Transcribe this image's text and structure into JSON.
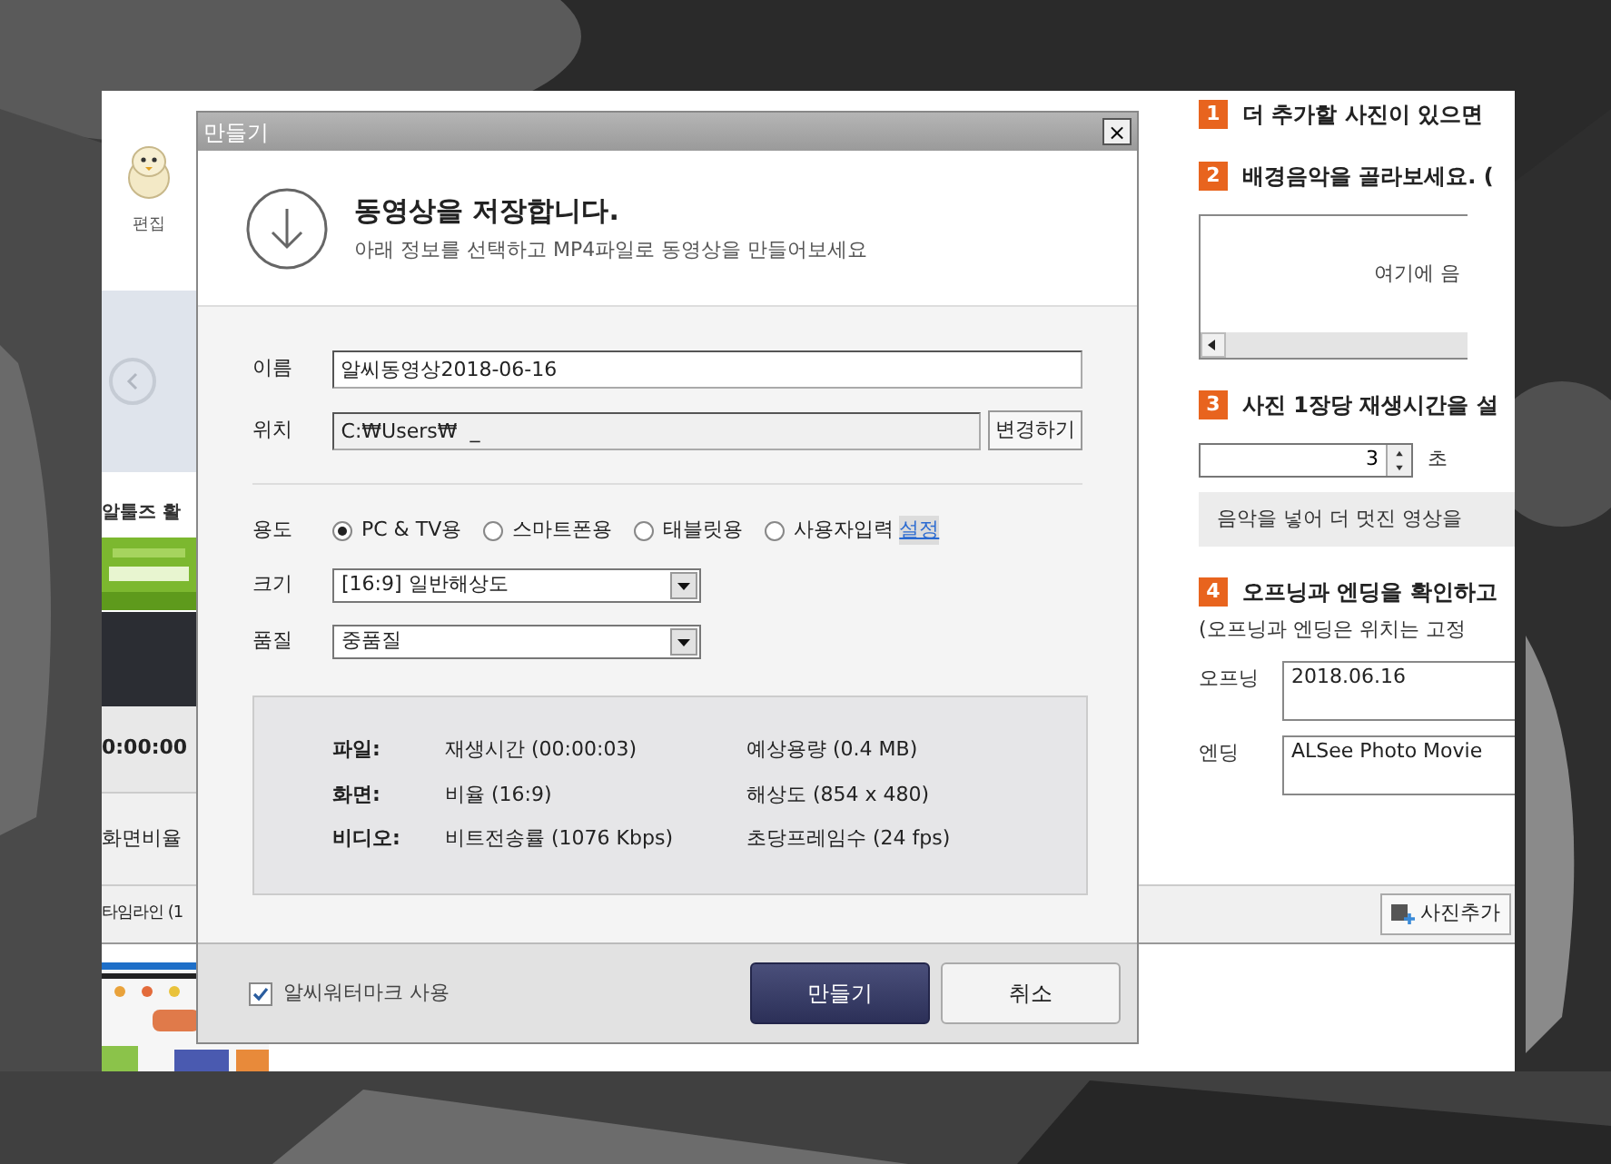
{
  "app": {
    "left_strip": {
      "profile_caption": "편집",
      "section_title": "알툴즈 활",
      "time": "0:00:00",
      "ratio_label": "화면비율"
    },
    "steps": [
      {
        "number": "1",
        "title": "더 추가할 사진이 있으면"
      },
      {
        "number": "2",
        "title": "배경음악을 골라보세요. (",
        "music_list": {
          "placeholder_text": "여기에 음"
        }
      },
      {
        "number": "3",
        "title": "사진 1장당 재생시간을 설",
        "duration": {
          "value": "3",
          "unit": "초"
        },
        "hint": "음악을 넣어 더 멋진 영상을"
      },
      {
        "number": "4",
        "title": "오프닝과 엔딩을 확인하고",
        "note": "(오프닝과 엔딩은 위치는 고정",
        "fields": [
          {
            "label": "오프닝",
            "value": "2018.06.16"
          },
          {
            "label": "엔딩",
            "value": "ALSee Photo Movie"
          }
        ]
      }
    ],
    "toolbar": {
      "timeline_label": "타임라인 (1",
      "add_photo_button": "사진추가"
    }
  },
  "dialog": {
    "title": "만들기",
    "close": "×",
    "heading": "동영상을 **저장**합니다.",
    "subheading": "아래 정보를 선택하고 MP4파일로 동영상을 만들어보세요",
    "name": {
      "label": "이름",
      "value": "알씨동영상2018-06-16"
    },
    "location": {
      "label": "위치",
      "value": "C:₩Users₩  _",
      "button": "변경하기"
    },
    "usage": {
      "label": "용도",
      "options": [
        {
          "label": "PC & TV용",
          "selected": true
        },
        {
          "label": "스마트폰용",
          "selected": false
        },
        {
          "label": "태블릿용",
          "selected": false
        },
        {
          "label": "사용자입력",
          "selected": false
        }
      ],
      "settings_link": "설정"
    },
    "size": {
      "label": "크기",
      "value": "[16:9] 일반해상도"
    },
    "quality": {
      "label": "품질",
      "value": "중품질"
    },
    "info": [
      {
        "label": "파일:",
        "left": "재생시간 (00:00:03)",
        "right": "예상용량 (0.4 MB)"
      },
      {
        "label": "화면:",
        "left": "비율 (16:9)",
        "right": "해상도 (854 x 480)"
      },
      {
        "label": "비디오:",
        "left": "비트전송률 (1076 Kbps)",
        "right": "초당프레임수 (24 fps)"
      }
    ],
    "watermark": {
      "label": "알씨워터마크 사용",
      "checked": true
    },
    "buttons": [
      {
        "label": "만들기",
        "kind": "primary"
      },
      {
        "label": "취소",
        "kind": "secondary"
      }
    ]
  }
}
